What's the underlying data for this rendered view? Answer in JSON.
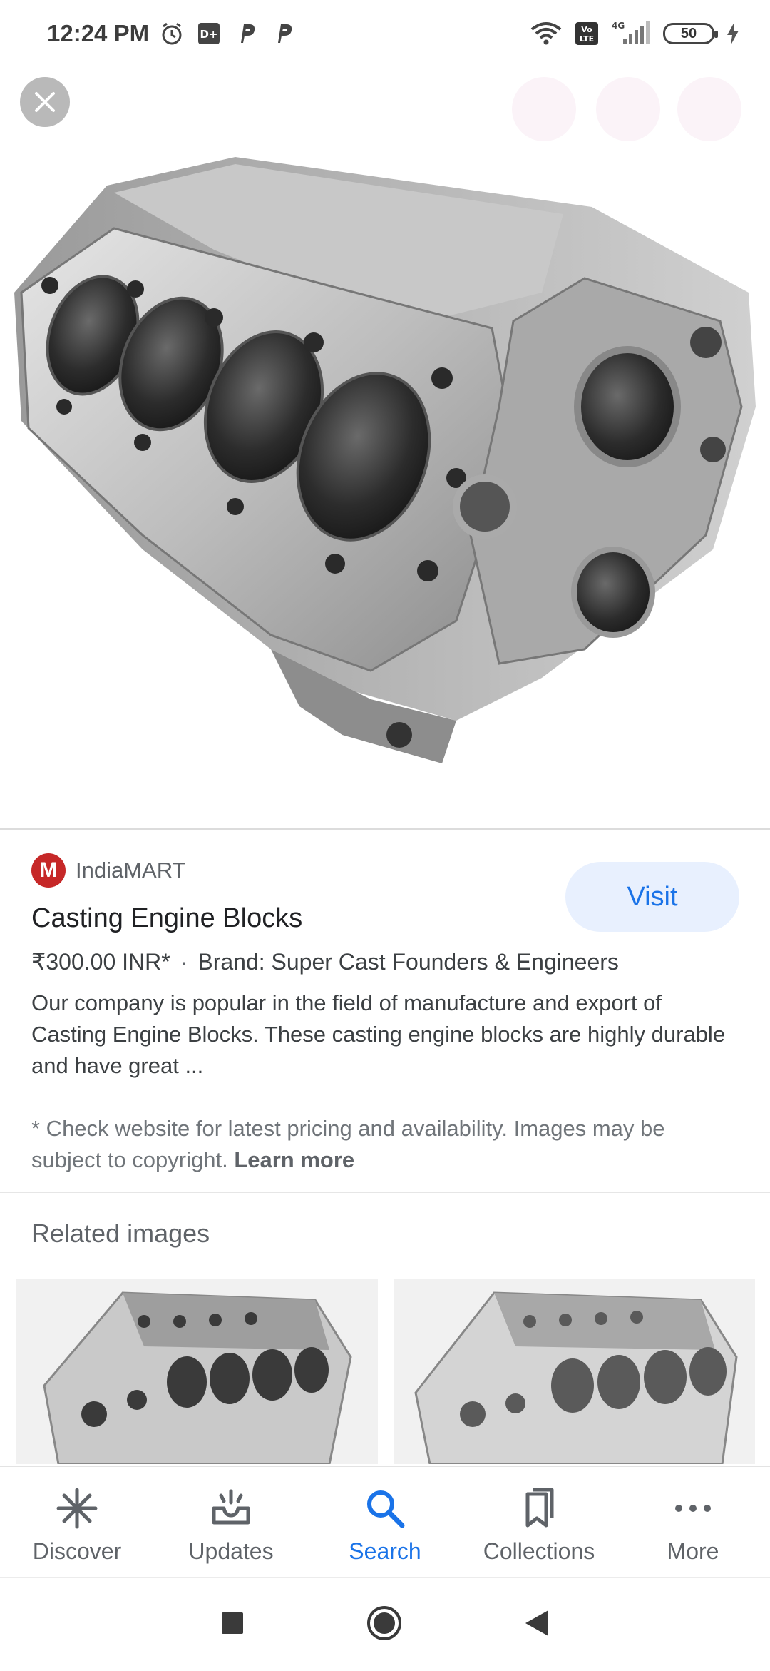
{
  "status_bar": {
    "time": "12:24 PM",
    "battery_level": "50",
    "network_type": "4G",
    "volte_label": "Vo LTE"
  },
  "source": {
    "name": "IndiaMART",
    "logo_letter": "M"
  },
  "visit_button": {
    "label": "Visit"
  },
  "product": {
    "title": "Casting Engine Blocks",
    "price": "₹300.00 INR*",
    "separator": "·",
    "brand": "Brand: Super Cast Founders & Engineers",
    "description": "Our company is popular in the field of manufacture and export of Casting Engine Blocks. These casting engine blocks are highly durable and have great ..."
  },
  "disclaimer": {
    "text": "* Check website for latest pricing and availability. Images may be subject to copyright.",
    "link": "Learn more"
  },
  "related": {
    "heading": "Related images"
  },
  "bottom_nav": {
    "items": [
      {
        "label": "Discover",
        "icon": "asterisk-icon"
      },
      {
        "label": "Updates",
        "icon": "updates-tray-icon"
      },
      {
        "label": "Search",
        "icon": "search-icon",
        "active": true
      },
      {
        "label": "Collections",
        "icon": "collections-icon"
      },
      {
        "label": "More",
        "icon": "more-dots-icon"
      }
    ]
  },
  "colors": {
    "accent": "#1a73e8",
    "visit_bg": "#e8f0fe",
    "brand_red": "#c62828",
    "text_primary": "#202124",
    "text_secondary": "#5f6368"
  }
}
